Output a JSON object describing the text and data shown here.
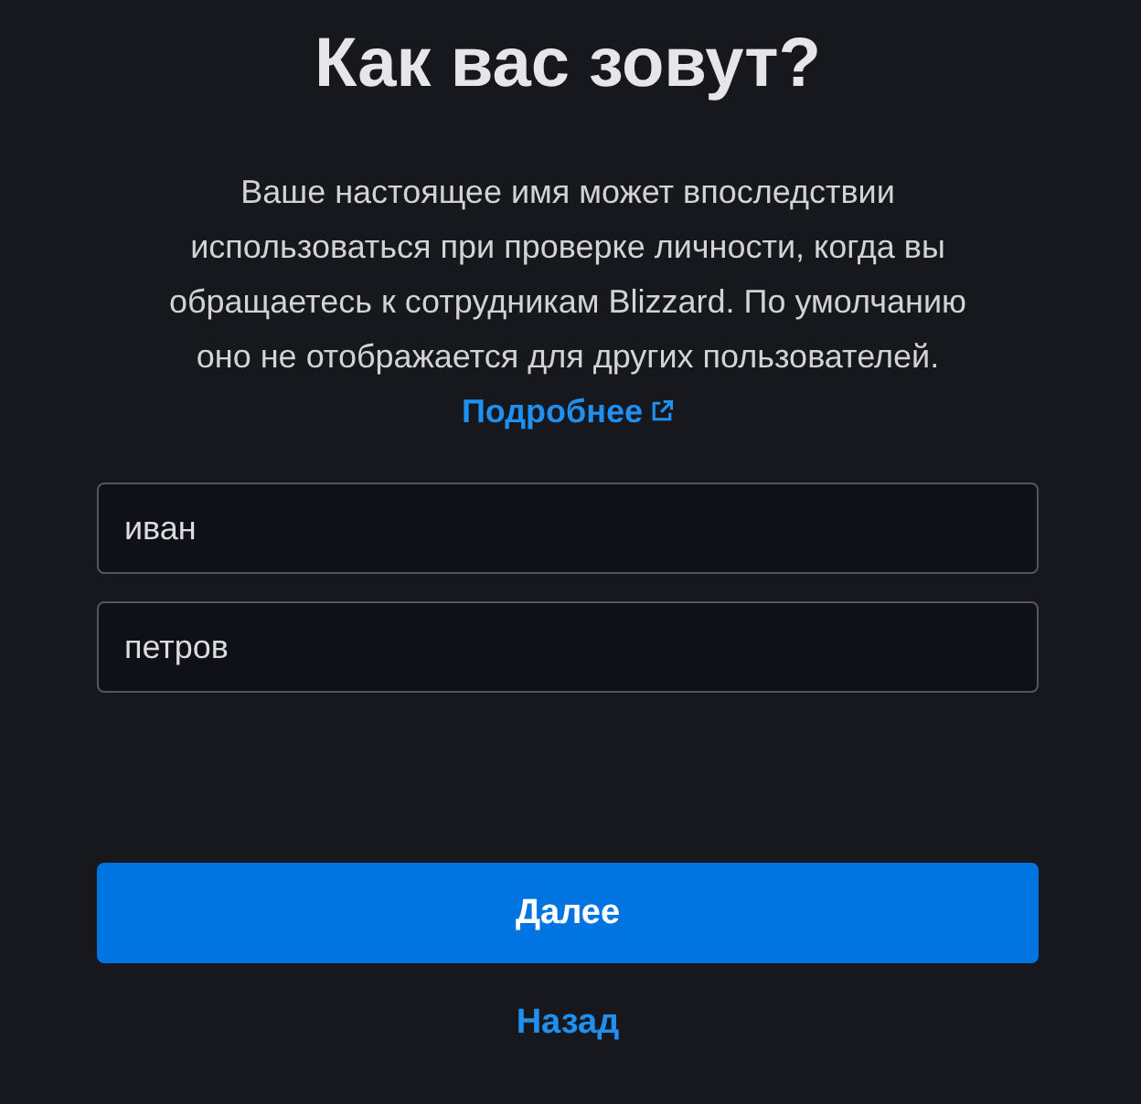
{
  "title": "Как вас зовут?",
  "description": {
    "text": "Ваше настоящее имя может впоследствии использоваться при проверке личности, когда вы обращаетесь к сотрудникам Blizzard. По умолчанию оно не отображается для других пользователей.",
    "link": "Подробнее"
  },
  "fields": [
    {
      "value": "иван"
    },
    {
      "value": "петров"
    }
  ],
  "primary_button": "Далее",
  "back_link": "Назад"
}
